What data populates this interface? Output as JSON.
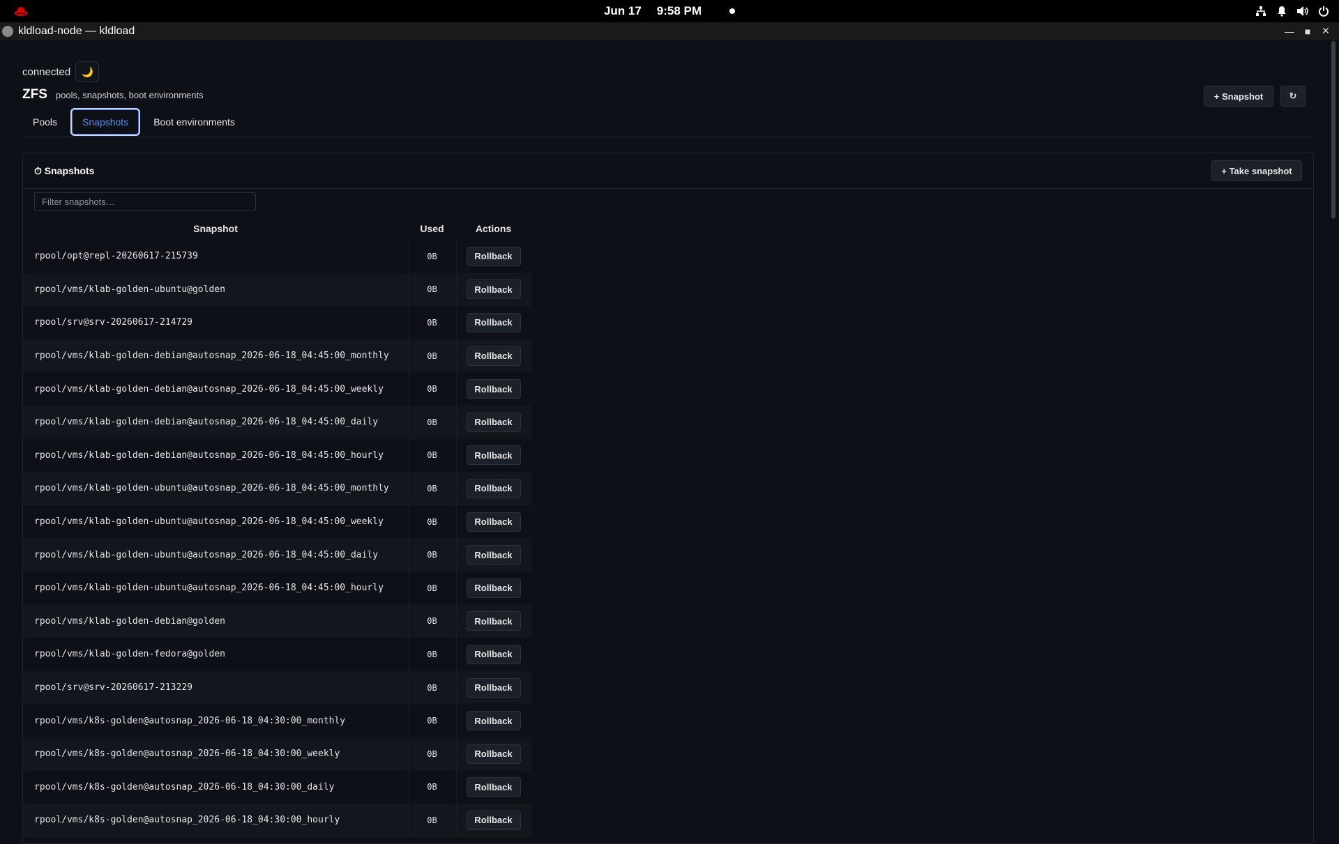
{
  "system": {
    "date": "Jun 17",
    "time": "9:58 PM"
  },
  "window": {
    "title": "kldload-node — kldload"
  },
  "status": {
    "connection": "connected",
    "theme_icon": "moon-icon"
  },
  "header": {
    "title": "ZFS",
    "subtitle": "pools, snapshots, boot environments",
    "snapshot_button": "+ Snapshot",
    "refresh_button": "↻"
  },
  "tabs": [
    {
      "label": "Pools",
      "active": false
    },
    {
      "label": "Snapshots",
      "active": true
    },
    {
      "label": "Boot environments",
      "active": false
    }
  ],
  "panel": {
    "title": "⏱ Snapshots",
    "take_button": "+ Take snapshot",
    "filter_placeholder": "Filter snapshots…",
    "columns": [
      "Snapshot",
      "Used",
      "Actions"
    ],
    "action_label": "Rollback",
    "rows": [
      {
        "name": "rpool/opt@repl-20260617-215739",
        "used": "0B"
      },
      {
        "name": "rpool/vms/klab-golden-ubuntu@golden",
        "used": "0B"
      },
      {
        "name": "rpool/srv@srv-20260617-214729",
        "used": "0B"
      },
      {
        "name": "rpool/vms/klab-golden-debian@autosnap_2026-06-18_04:45:00_monthly",
        "used": "0B"
      },
      {
        "name": "rpool/vms/klab-golden-debian@autosnap_2026-06-18_04:45:00_weekly",
        "used": "0B"
      },
      {
        "name": "rpool/vms/klab-golden-debian@autosnap_2026-06-18_04:45:00_daily",
        "used": "0B"
      },
      {
        "name": "rpool/vms/klab-golden-debian@autosnap_2026-06-18_04:45:00_hourly",
        "used": "0B"
      },
      {
        "name": "rpool/vms/klab-golden-ubuntu@autosnap_2026-06-18_04:45:00_monthly",
        "used": "0B"
      },
      {
        "name": "rpool/vms/klab-golden-ubuntu@autosnap_2026-06-18_04:45:00_weekly",
        "used": "0B"
      },
      {
        "name": "rpool/vms/klab-golden-ubuntu@autosnap_2026-06-18_04:45:00_daily",
        "used": "0B"
      },
      {
        "name": "rpool/vms/klab-golden-ubuntu@autosnap_2026-06-18_04:45:00_hourly",
        "used": "0B"
      },
      {
        "name": "rpool/vms/klab-golden-debian@golden",
        "used": "0B"
      },
      {
        "name": "rpool/vms/klab-golden-fedora@golden",
        "used": "0B"
      },
      {
        "name": "rpool/srv@srv-20260617-213229",
        "used": "0B"
      },
      {
        "name": "rpool/vms/k8s-golden@autosnap_2026-06-18_04:30:00_monthly",
        "used": "0B"
      },
      {
        "name": "rpool/vms/k8s-golden@autosnap_2026-06-18_04:30:00_weekly",
        "used": "0B"
      },
      {
        "name": "rpool/vms/k8s-golden@autosnap_2026-06-18_04:30:00_daily",
        "used": "0B"
      },
      {
        "name": "rpool/vms/k8s-golden@autosnap_2026-06-18_04:30:00_hourly",
        "used": "0B"
      }
    ]
  },
  "colors": {
    "background": "#0d1117",
    "accent": "#5a8cf0",
    "brand": "#e00000"
  }
}
